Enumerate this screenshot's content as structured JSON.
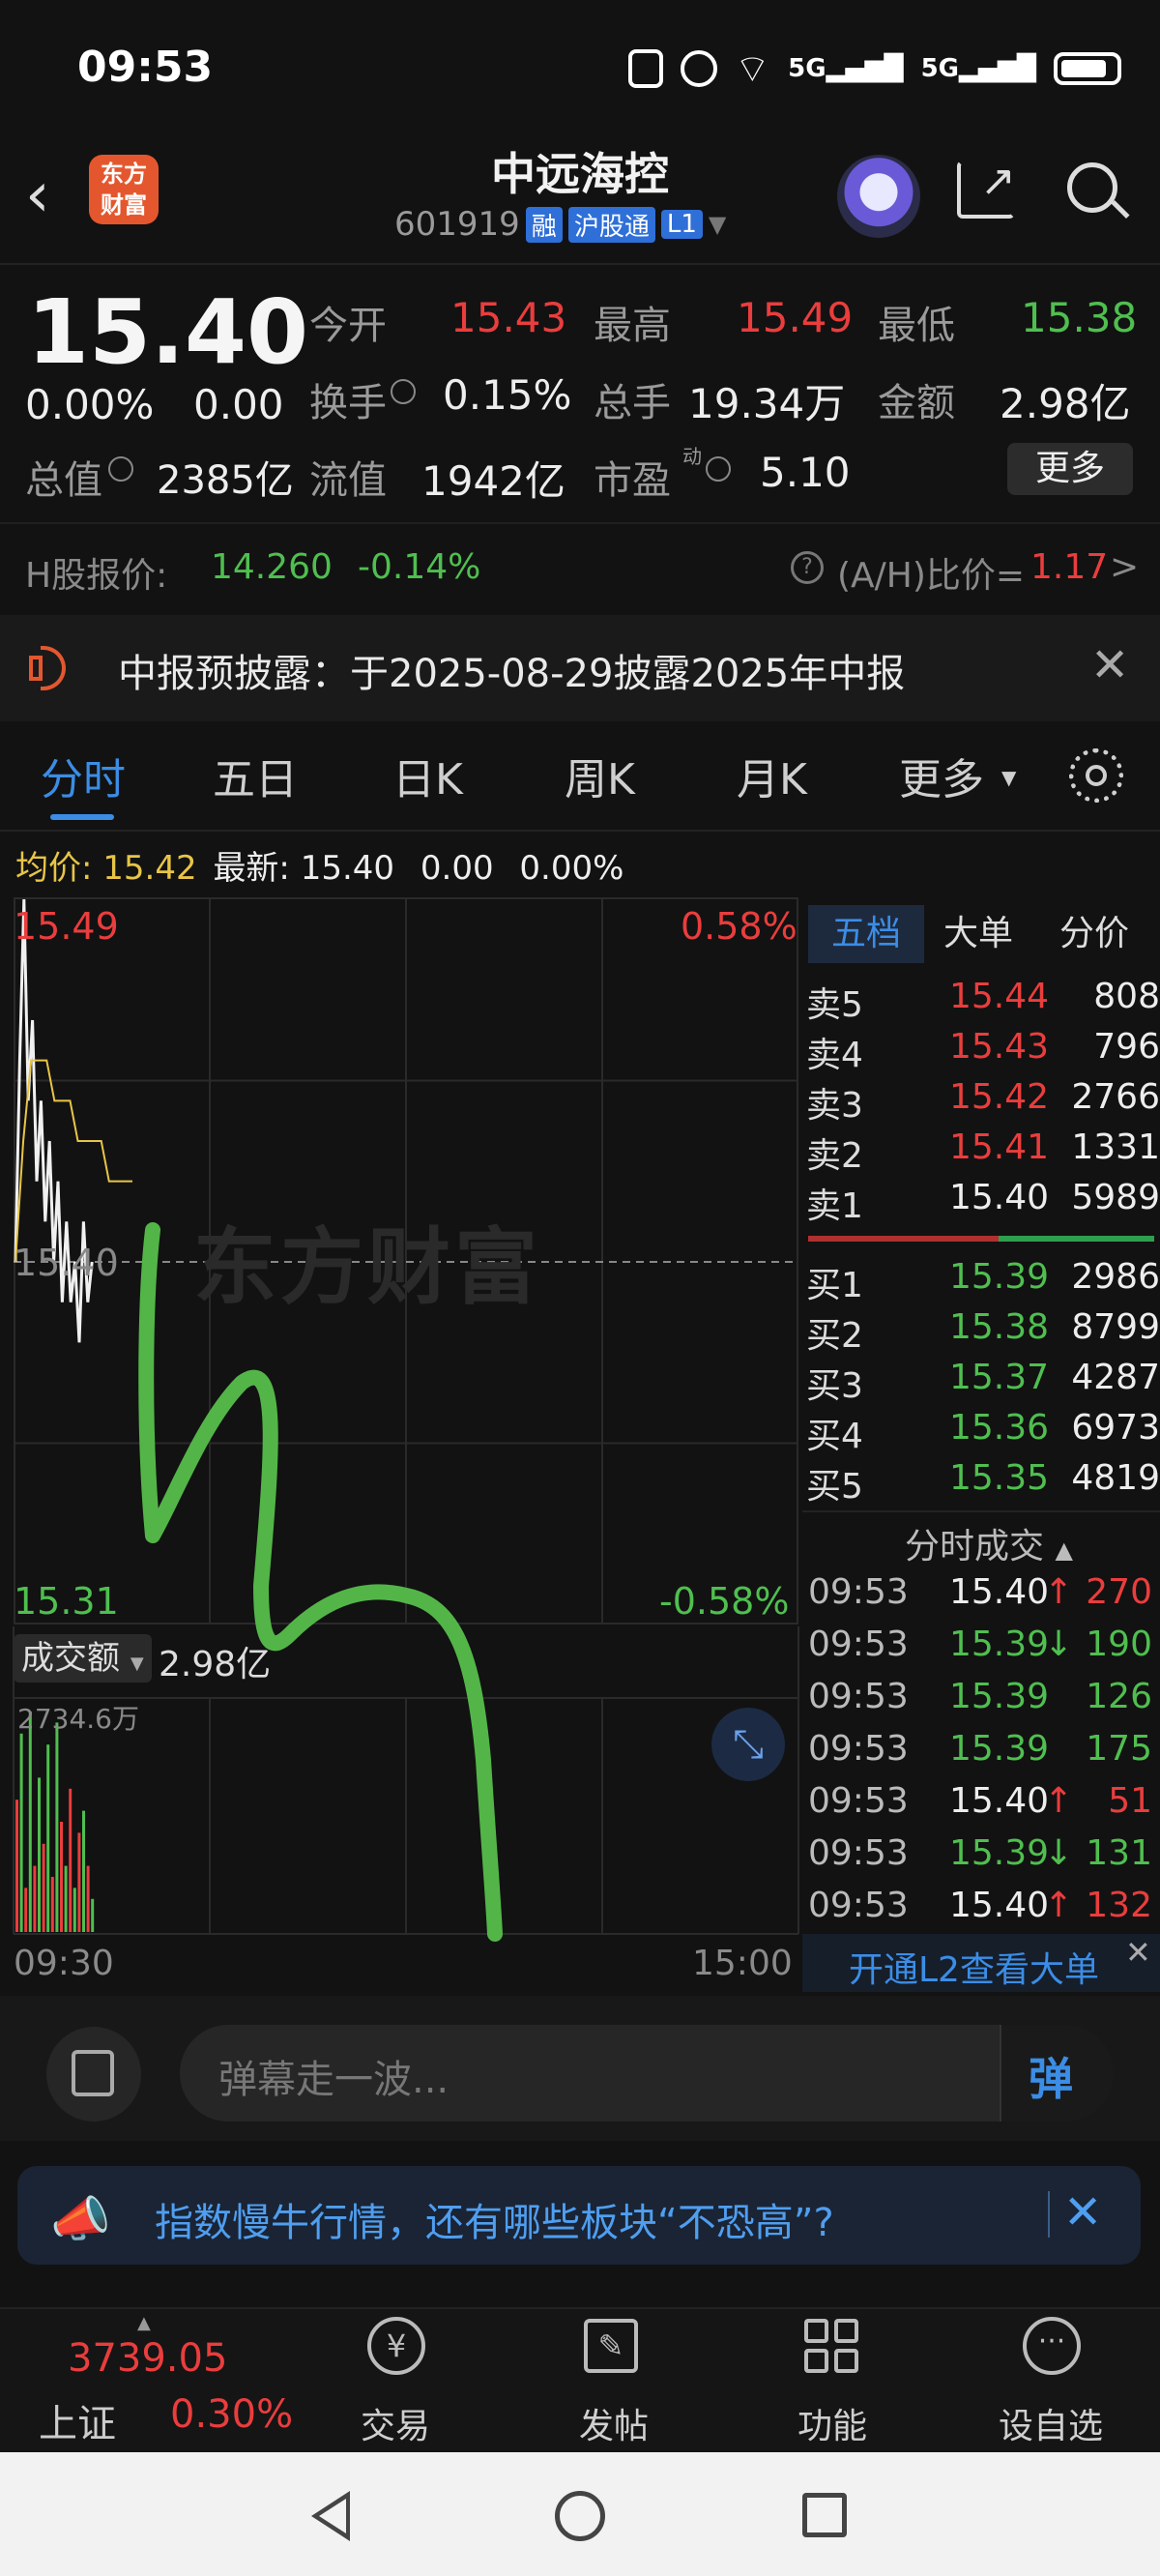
{
  "status_bar": {
    "time": "09:53",
    "net1": "5G",
    "net2": "5G"
  },
  "header": {
    "app_logo": "东方\n财富",
    "stock_name": "中远海控",
    "stock_code": "601919",
    "tag_margin": "融",
    "tag_connect": "沪股通",
    "tag_level": "L1"
  },
  "quote": {
    "price": "15.40",
    "change_pct": "0.00%",
    "change": "0.00",
    "open_label": "今开",
    "open": "15.43",
    "high_label": "最高",
    "high": "15.49",
    "low_label": "最低",
    "low": "15.38",
    "turnover_label": "换手",
    "turnover": "0.15%",
    "volume_label": "总手",
    "volume": "19.34万",
    "amount_label": "金额",
    "amount": "2.98亿",
    "mktcap_label": "总值",
    "mktcap": "2385亿",
    "float_label": "流值",
    "float": "1942亿",
    "pe_label": "市盈",
    "pe_sup": "动",
    "pe": "5.10",
    "more_button": "更多"
  },
  "hshare": {
    "label": "H股报价:",
    "price": "14.260",
    "change": "-0.14%",
    "ah_label": "(A/H)比价=",
    "ah_value": "1.17",
    "arrow": ">"
  },
  "notice": {
    "text": "中报预披露：于2025-08-29披露2025年中报"
  },
  "chart_tabs": [
    "分时",
    "五日",
    "日K",
    "周K",
    "月K",
    "更多"
  ],
  "info_line": {
    "avg_label": "均价:",
    "avg": "15.42",
    "latest_label": "最新:",
    "latest": "15.40",
    "chg": "0.00",
    "chg_pct": "0.00%"
  },
  "chart": {
    "y_top": "15.49",
    "y_mid": "15.40",
    "y_bottom": "15.31",
    "pct_top": "0.58%",
    "pct_bottom": "-0.58%",
    "x_start": "09:30",
    "x_end": "15:00",
    "watermark": "东方财富",
    "volume_label": "成交额",
    "volume_value": "2.98亿",
    "volume_max": "2734.6万"
  },
  "chart_data": {
    "type": "line",
    "title": "",
    "xlabel": "",
    "ylabel": "",
    "ylim": [
      15.31,
      15.49
    ],
    "series": [
      {
        "name": "",
        "values": [
          15.4,
          15.45,
          15.49,
          15.44,
          15.46,
          15.42,
          15.44,
          15.41,
          15.43,
          15.4,
          15.42,
          15.39,
          15.41,
          15.39,
          15.4,
          15.38,
          15.41,
          15.39,
          15.4
        ]
      },
      {
        "name": "均价",
        "values": [
          15.4,
          15.43,
          15.45,
          15.45,
          15.45,
          15.44,
          15.44,
          15.44,
          15.43,
          15.43,
          15.43,
          15.43,
          15.42,
          15.42,
          15.42,
          15.42
        ]
      }
    ],
    "volume": [
      60,
      90,
      20,
      100,
      30,
      70,
      40,
      85,
      25,
      95,
      50,
      30,
      65,
      20,
      45,
      55,
      30,
      15
    ]
  },
  "order_book": {
    "tabs": [
      "五档",
      "大单",
      "分价"
    ],
    "asks": [
      {
        "label": "卖5",
        "price": "15.44",
        "vol": "808"
      },
      {
        "label": "卖4",
        "price": "15.43",
        "vol": "796"
      },
      {
        "label": "卖3",
        "price": "15.42",
        "vol": "2766"
      },
      {
        "label": "卖2",
        "price": "15.41",
        "vol": "1331"
      },
      {
        "label": "卖1",
        "price": "15.40",
        "vol": "5989"
      }
    ],
    "bids": [
      {
        "label": "买1",
        "price": "15.39",
        "vol": "2986"
      },
      {
        "label": "买2",
        "price": "15.38",
        "vol": "8799"
      },
      {
        "label": "买3",
        "price": "15.37",
        "vol": "4287"
      },
      {
        "label": "买4",
        "price": "15.36",
        "vol": "6973"
      },
      {
        "label": "买5",
        "price": "15.35",
        "vol": "4819"
      }
    ]
  },
  "trades": {
    "header": "分时成交",
    "rows": [
      {
        "time": "09:53",
        "price": "15.40",
        "dir": "↑",
        "vol": "270"
      },
      {
        "time": "09:53",
        "price": "15.39",
        "dir": "↓",
        "vol": "190"
      },
      {
        "time": "09:53",
        "price": "15.39",
        "dir": "",
        "vol": "126"
      },
      {
        "time": "09:53",
        "price": "15.39",
        "dir": "",
        "vol": "175"
      },
      {
        "time": "09:53",
        "price": "15.40",
        "dir": "↑",
        "vol": "51"
      },
      {
        "time": "09:53",
        "price": "15.39",
        "dir": "↓",
        "vol": "131"
      },
      {
        "time": "09:53",
        "price": "15.40",
        "dir": "↑",
        "vol": "132"
      }
    ],
    "l2_link": "开通L2查看大单"
  },
  "danmu": {
    "placeholder": "弹幕走一波...",
    "button": "弹"
  },
  "promo": {
    "text": "指数慢牛行情，还有哪些板块“不恐高”?"
  },
  "bottom_nav": {
    "index_value": "3739.05",
    "index_name": "上证",
    "index_change": "0.30%",
    "items": [
      "交易",
      "发帖",
      "功能",
      "设自选"
    ]
  }
}
